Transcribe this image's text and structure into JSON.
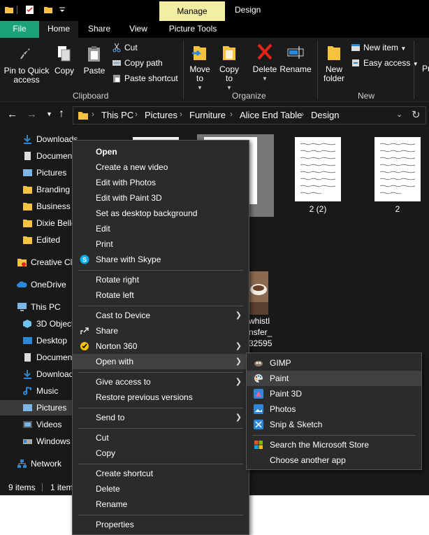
{
  "titlebar": {
    "manage": "Manage",
    "title": "Design"
  },
  "tabs": {
    "file": "File",
    "home": "Home",
    "share": "Share",
    "view": "View",
    "picture_tools": "Picture Tools"
  },
  "ribbon": {
    "pin": "Pin to Quick access",
    "copy": "Copy",
    "paste": "Paste",
    "cut": "Cut",
    "copy_path": "Copy path",
    "paste_shortcut": "Paste shortcut",
    "clipboard": "Clipboard",
    "move_to": "Move to",
    "copy_to": "Copy to",
    "delete": "Delete",
    "rename": "Rename",
    "organize": "Organize",
    "new_folder": "New folder",
    "new_item": "New item",
    "easy_access": "Easy access",
    "new": "New",
    "properties_partial": "Pr"
  },
  "breadcrumb": [
    "This PC",
    "Pictures",
    "Furniture",
    "Alice End Table",
    "Design"
  ],
  "nav": {
    "downloads": "Downloads",
    "documents": "Documents",
    "pictures": "Pictures",
    "branding": "Branding",
    "business": "Business C",
    "dixie": "Dixie Belle",
    "edited": "Edited",
    "creative": "Creative Cloud Files",
    "onedrive": "OneDrive",
    "thispc": "This PC",
    "objects3d": "3D Objects",
    "desktop": "Desktop",
    "documents2": "Documents",
    "downloads2": "Downloads",
    "music": "Music",
    "pictures2": "Pictures",
    "videos": "Videos",
    "windows": "Windows (C:)",
    "network": "Network"
  },
  "files": [
    {
      "label": "2 (2)"
    },
    {
      "label": "2"
    },
    {
      "label_line1": "whistl",
      "label_line2": "nsfer_",
      "label_line3": "32595"
    }
  ],
  "status": {
    "items": "9 items",
    "selected": "1 item"
  },
  "context_menu": {
    "open": "Open",
    "create_video": "Create a new video",
    "edit_photos": "Edit with Photos",
    "edit_paint3d": "Edit with Paint 3D",
    "set_desktop": "Set as desktop background",
    "edit": "Edit",
    "print": "Print",
    "share_skype": "Share with Skype",
    "rotate_right": "Rotate right",
    "rotate_left": "Rotate left",
    "cast": "Cast to Device",
    "share": "Share",
    "norton": "Norton 360",
    "open_with": "Open with",
    "give_access": "Give access to",
    "restore": "Restore previous versions",
    "send_to": "Send to",
    "cut": "Cut",
    "copy": "Copy",
    "create_shortcut": "Create shortcut",
    "delete": "Delete",
    "rename": "Rename",
    "properties": "Properties"
  },
  "submenu": {
    "gimp": "GIMP",
    "paint": "Paint",
    "paint3d": "Paint 3D",
    "photos": "Photos",
    "snip": "Snip & Sketch",
    "store": "Search the Microsoft Store",
    "another": "Choose another app"
  },
  "colors": {
    "file_tab": "#1aa37a",
    "manage": "#f2efa3",
    "folder": "#f5c242",
    "accent": "#2b88d8"
  }
}
